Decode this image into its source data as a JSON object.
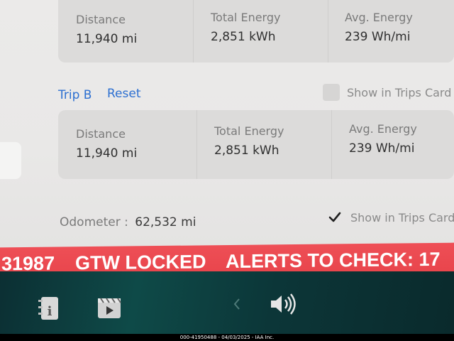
{
  "trip_a": {
    "distance_label": "Distance",
    "distance_value": "11,940  mi",
    "energy_label": "Total Energy",
    "energy_value": "2,851 kWh",
    "avg_label": "Avg. Energy",
    "avg_value": "239 Wh/mi"
  },
  "trip_b": {
    "title": "Trip B",
    "reset_label": "Reset",
    "show_in_trips_label": "Show in Trips Card",
    "show_in_trips_checked": false,
    "distance_label": "Distance",
    "distance_value": "11,940  mi",
    "energy_label": "Total Energy",
    "energy_value": "2,851 kWh",
    "avg_label": "Avg. Energy",
    "avg_value": "239 Wh/mi"
  },
  "odometer": {
    "label": "Odometer  :",
    "value": "62,532 mi",
    "show_in_trips_label": "Show in Trips Card",
    "show_in_trips_checked": true
  },
  "alert_bar": {
    "code": "31987",
    "gtw_text": "GTW LOCKED",
    "alerts_text": "ALERTS TO CHECK: 17",
    "color": "#ea474e"
  },
  "taskbar": {
    "icons": [
      "manual-icon",
      "video-icon",
      "chevron-left-icon",
      "volume-icon"
    ]
  },
  "footer_text": "000-41950488 - 04/03/2025 - IAA Inc."
}
